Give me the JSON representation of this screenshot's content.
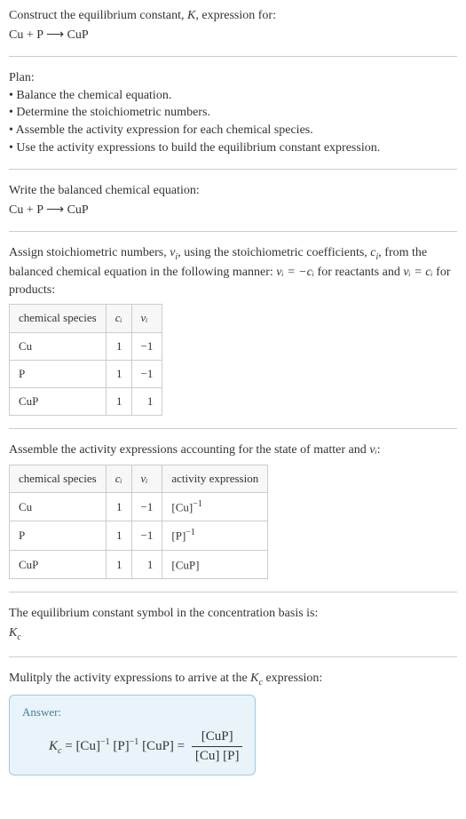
{
  "header": {
    "line1_a": "Construct the equilibrium constant, ",
    "line1_k": "K",
    "line1_b": ", expression for:",
    "equation": "Cu + P ⟶ CuP"
  },
  "plan": {
    "title": "Plan:",
    "steps": [
      "• Balance the chemical equation.",
      "• Determine the stoichiometric numbers.",
      "• Assemble the activity expression for each chemical species.",
      "• Use the activity expressions to build the equilibrium constant expression."
    ]
  },
  "balanced": {
    "label": "Write the balanced chemical equation:",
    "equation": "Cu + P ⟶ CuP"
  },
  "assign": {
    "text_a": "Assign stoichiometric numbers, ",
    "nu": "ν",
    "i": "i",
    "text_b": ", using the stoichiometric coefficients, ",
    "c": "c",
    "text_c": ", from the balanced chemical equation in the following manner: ",
    "rel1": "νᵢ = −cᵢ",
    "text_d": " for reactants and ",
    "rel2": "νᵢ = cᵢ",
    "text_e": " for products:"
  },
  "table1": {
    "headers": {
      "species": "chemical species",
      "ci": "cᵢ",
      "nui": "νᵢ"
    },
    "rows": [
      {
        "species": "Cu",
        "ci": "1",
        "nui": "−1"
      },
      {
        "species": "P",
        "ci": "1",
        "nui": "−1"
      },
      {
        "species": "CuP",
        "ci": "1",
        "nui": "1"
      }
    ]
  },
  "assemble": {
    "text_a": "Assemble the activity expressions accounting for the state of matter and ",
    "nu": "νᵢ",
    "text_b": ":"
  },
  "table2": {
    "headers": {
      "species": "chemical species",
      "ci": "cᵢ",
      "nui": "νᵢ",
      "activity": "activity expression"
    },
    "rows": [
      {
        "species": "Cu",
        "ci": "1",
        "nui": "−1",
        "act_base": "[Cu]",
        "act_exp": "−1"
      },
      {
        "species": "P",
        "ci": "1",
        "nui": "−1",
        "act_base": "[P]",
        "act_exp": "−1"
      },
      {
        "species": "CuP",
        "ci": "1",
        "nui": "1",
        "act_base": "[CuP]",
        "act_exp": ""
      }
    ]
  },
  "symbol": {
    "label": "The equilibrium constant symbol in the concentration basis is:",
    "kc": "K",
    "c": "c"
  },
  "multiply": {
    "text_a": "Mulitply the activity expressions to arrive at the ",
    "kc": "K",
    "c": "c",
    "text_b": " expression:"
  },
  "answer": {
    "label": "Answer:",
    "lhs_k": "K",
    "lhs_c": "c",
    "eq": " = ",
    "term1_base": "[Cu]",
    "term1_exp": "−1",
    "term2_base": "[P]",
    "term2_exp": "−1",
    "term3": "[CuP]",
    "eq2": " = ",
    "frac_num": "[CuP]",
    "frac_den": "[Cu] [P]"
  }
}
